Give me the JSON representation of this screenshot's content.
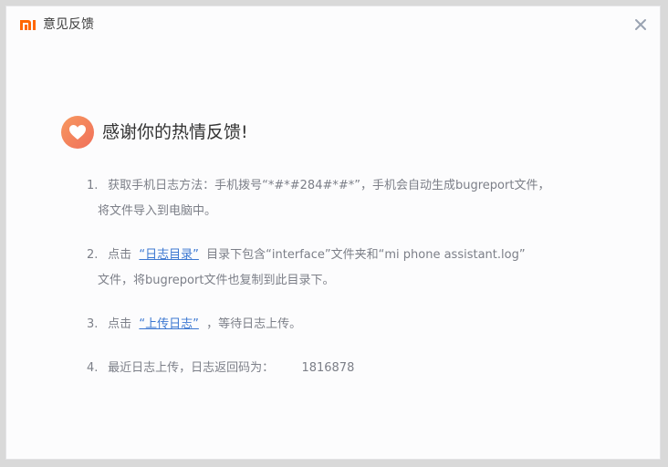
{
  "window": {
    "title": "意见反馈",
    "logo_text": "mi",
    "close_icon": "close-icon"
  },
  "heading": {
    "icon": "heart-icon",
    "text": "感谢你的热情反馈!"
  },
  "steps": [
    {
      "number": "1.",
      "line1": "获取手机日志方法：手机拨号“*#*#284#*#*”，手机会自动生成bugreport文件，",
      "line2": "将文件导入到电脑中。"
    },
    {
      "number": "2.",
      "prefix": "点击",
      "link": "“日志目录”",
      "suffix": "目录下包含“interface”文件夹和“mi phone assistant.log”",
      "line2": "文件，将bugreport文件也复制到此目录下。"
    },
    {
      "number": "3.",
      "prefix": "点击",
      "link": "“上传日志”",
      "suffix": "，等待日志上传。"
    },
    {
      "number": "4.",
      "text": "最近日志上传，日志返回码为：",
      "code": "1816878"
    }
  ],
  "colors": {
    "brand": "#ff6700",
    "link": "#3b77d1",
    "heart_gradient_start": "#f7985f",
    "heart_gradient_end": "#f06f5a"
  }
}
